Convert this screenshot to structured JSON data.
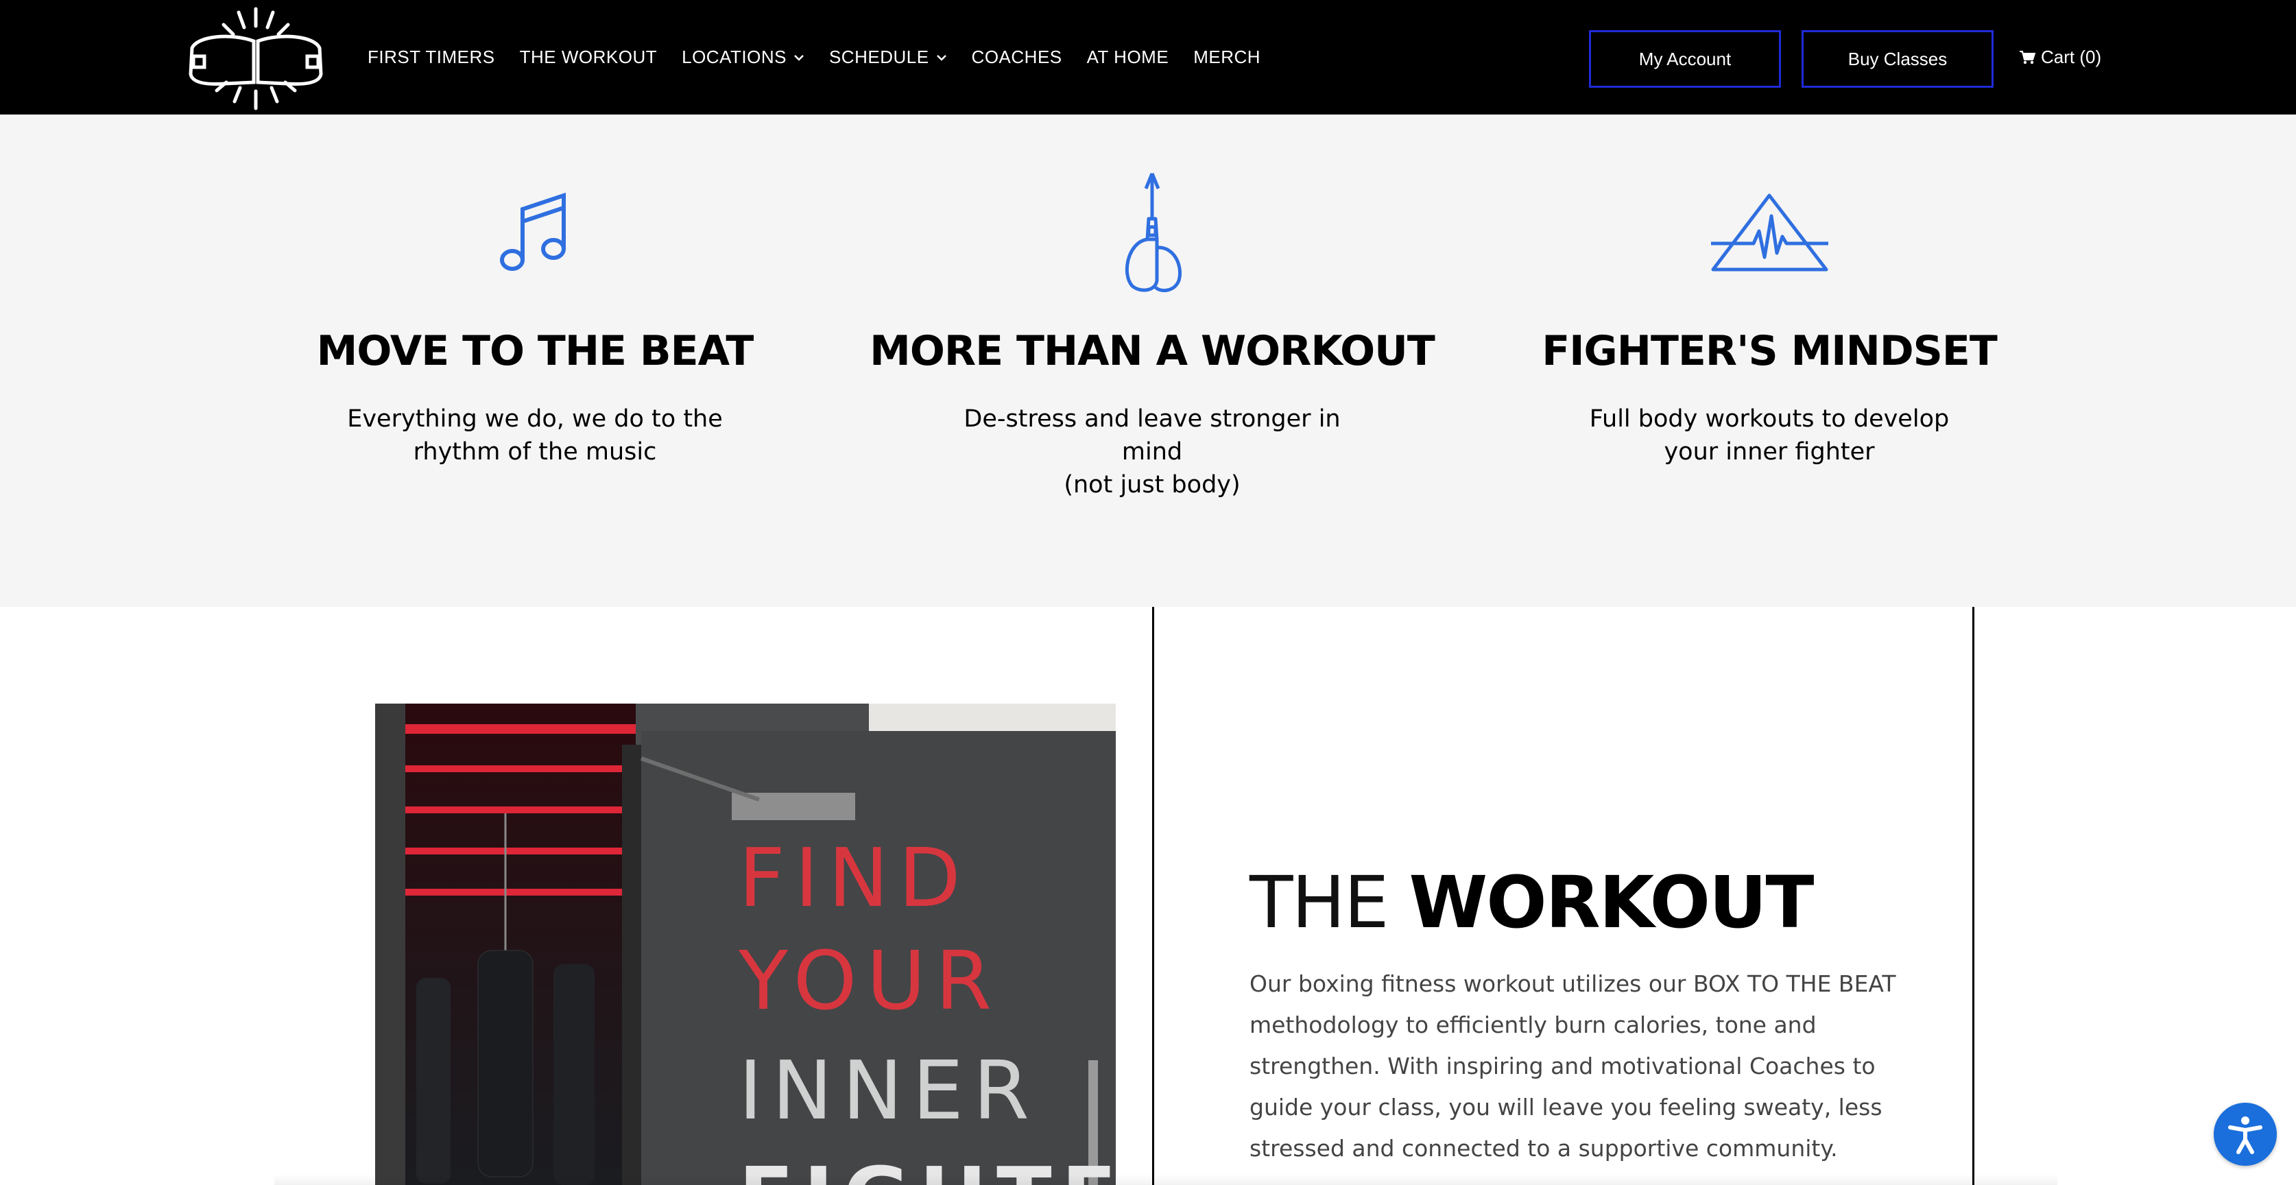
{
  "nav": {
    "links": [
      "FIRST TIMERS",
      "THE WORKOUT",
      "LOCATIONS",
      "SCHEDULE",
      "COACHES",
      "AT HOME",
      "MERCH"
    ],
    "my_account": "My Account",
    "buy_classes": "Buy Classes",
    "cart": "Cart (0)"
  },
  "features": [
    {
      "icon": "music-note-icon",
      "title": "MOVE TO THE BEAT",
      "text_line1": "Everything we do, we do to the",
      "text_line2": "rhythm of the music"
    },
    {
      "icon": "boxing-gloves-icon",
      "title": "MORE THAN A WORKOUT",
      "text_line1": "De-stress and leave stronger in mind",
      "text_line2": "(not just body)"
    },
    {
      "icon": "heartbeat-triangle-icon",
      "title": "FIGHTER'S MINDSET",
      "text_line1": "Full body workouts to develop",
      "text_line2": "your inner fighter"
    }
  ],
  "workout": {
    "title_light": "THE ",
    "title_bold": "WORKOUT",
    "body": "Our boxing fitness workout utilizes our BOX TO THE BEAT methodology to efficiently burn calories, tone and strengthen. With inspiring and motivational Coaches to guide your class, you will leave you feeling sweaty, less stressed and connected to a supportive community.",
    "photo_text": [
      "FIND",
      "YOUR",
      "INNER",
      "FIGHTER"
    ]
  },
  "colors": {
    "accent_blue": "#2f6fe0",
    "button_border": "#1f2bd6",
    "feature_bg": "#f5f5f5"
  }
}
